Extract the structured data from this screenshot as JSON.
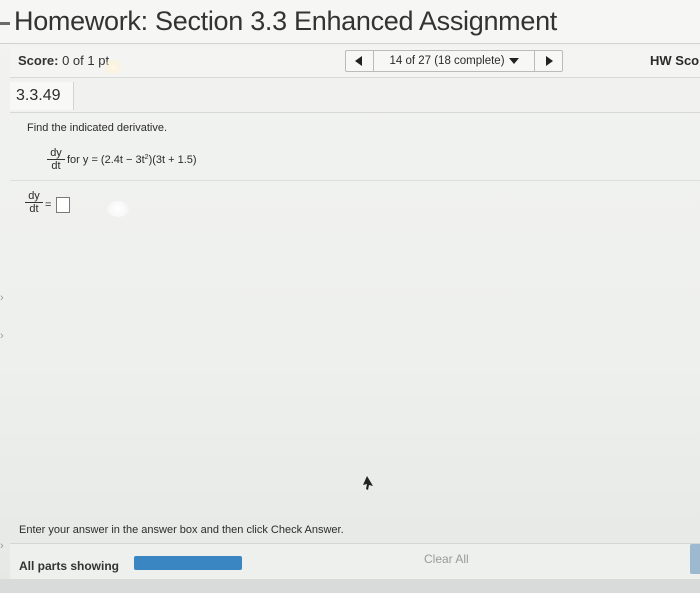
{
  "header": {
    "title": "Homework: Section 3.3 Enhanced Assignment"
  },
  "score_bar": {
    "score_label": "Score:",
    "score_value": "0 of 1 pt",
    "nav_position": "14 of 27 (18 complete)",
    "hw_score_label": "HW Sco"
  },
  "problem": {
    "number": "3.3.49",
    "instructions": "Find the indicated derivative.",
    "derivative_num": "dy",
    "derivative_den": "dt",
    "expression_prefix": "for y = (2.4t − 3t",
    "expression_exponent": "2",
    "expression_suffix": ")(3t + 1.5)"
  },
  "answer": {
    "num": "dy",
    "den": "dt",
    "equals": "=",
    "value": ""
  },
  "footer": {
    "message": "Enter your answer in the answer box and then click Check Answer.",
    "parts_label": "All parts showing",
    "parts_progress": 1.0,
    "clear_all": "Clear All"
  },
  "colors": {
    "progress_fill": "#3a86c3",
    "accent": "#9db9cf"
  },
  "icons": {
    "prev": "triangle-left-icon",
    "next": "triangle-right-icon",
    "dropdown": "caret-down-icon",
    "cursor": "mouse-pointer-icon"
  }
}
